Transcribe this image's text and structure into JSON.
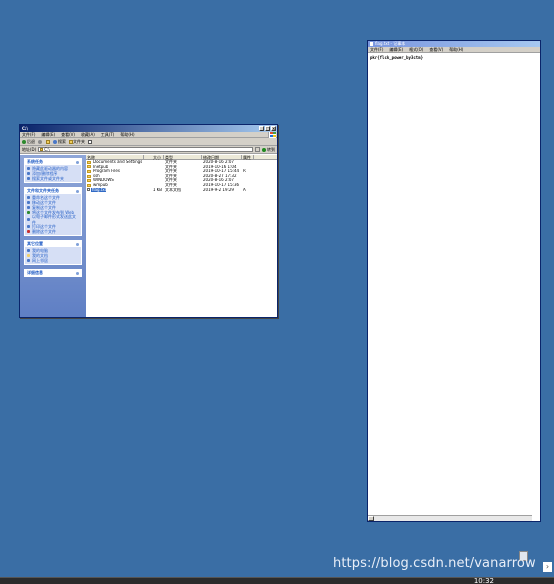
{
  "explorer": {
    "title": "C:\\",
    "menu": [
      "文件(F)",
      "编辑(E)",
      "查看(V)",
      "收藏(A)",
      "工具(T)",
      "帮助(H)"
    ],
    "toolbar": {
      "back": "后退",
      "search": "搜索",
      "folders": "文件夹"
    },
    "address": {
      "label": "地址(D)",
      "value": "C:\\",
      "go": "转到"
    },
    "panels": [
      {
        "title": "系统任务",
        "items": [
          "隐藏此驱动器的内容",
          "添加/删除程序",
          "搜索文件或文件夹"
        ]
      },
      {
        "title": "文件和文件夹任务",
        "items": [
          "重命名这个文件",
          "移动这个文件",
          "复制这个文件",
          "将这个文件发布到 Web",
          "以电子邮件形式发送此文件",
          "打印这个文件",
          "删除这个文件"
        ]
      },
      {
        "title": "其它位置",
        "items": [
          "我的电脑",
          "我的文档",
          "网上邻居"
        ]
      },
      {
        "title": "详细信息",
        "items": []
      }
    ],
    "columns": {
      "name": "名称",
      "size": "大小",
      "type": "类型",
      "date": "修改日期",
      "attr": "属性"
    },
    "files": [
      {
        "name": "Documents and Settings",
        "size": "",
        "type": "文件夹",
        "date": "2020-8-16 2:07",
        "attr": ""
      },
      {
        "name": "Inetpub",
        "size": "",
        "type": "文件夹",
        "date": "2019-10-16 1:04",
        "attr": ""
      },
      {
        "name": "Program Files",
        "size": "",
        "type": "文件夹",
        "date": "2019-10-17 15:44",
        "attr": "R"
      },
      {
        "name": "ssh",
        "size": "",
        "type": "文件夹",
        "date": "2020-8-27 17:32",
        "attr": ""
      },
      {
        "name": "WINDOWS",
        "size": "",
        "type": "文件夹",
        "date": "2020-8-16 2:07",
        "attr": ""
      },
      {
        "name": "wmpub",
        "size": "",
        "type": "文件夹",
        "date": "2019-10-17 15:36",
        "attr": ""
      },
      {
        "name": "flag.txt",
        "size": "1 KB",
        "type": "文本文档",
        "date": "2019-9-2 19:29",
        "attr": "A"
      }
    ]
  },
  "notepad": {
    "title": "flag.txt - 记事本",
    "menu": [
      "文件(F)",
      "编辑(E)",
      "格式(O)",
      "查看(V)",
      "帮助(H)"
    ],
    "content": "pkr{flck_power_by3ctm}"
  },
  "desktop": {
    "watermark": "https://blog.csdn.net/vanarrow",
    "clock": "10:32"
  }
}
